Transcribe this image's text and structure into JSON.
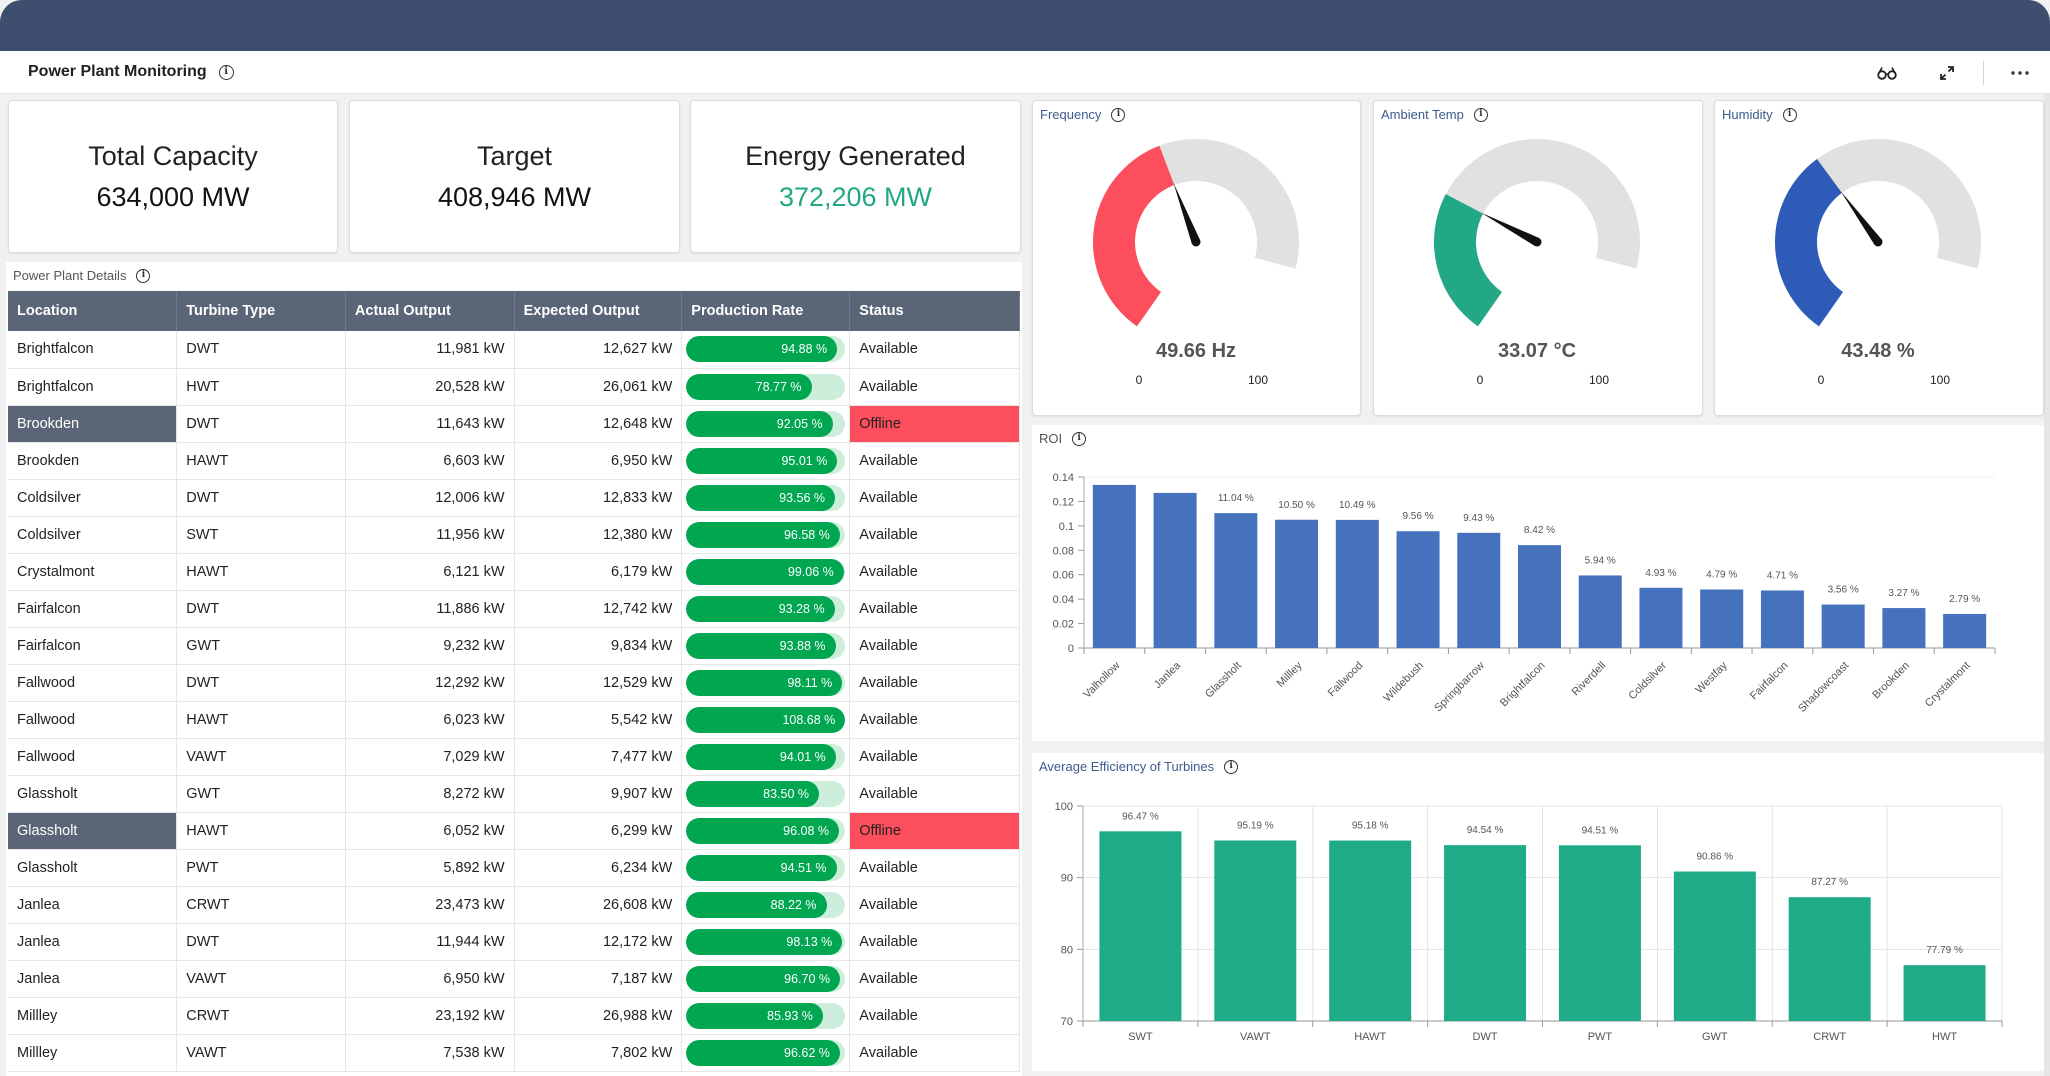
{
  "app": {
    "title": "Power Plant Monitoring",
    "actions": [
      {
        "name": "glasses-icon",
        "glyph": "⚇⚇"
      },
      {
        "name": "expand-icon",
        "glyph": "⤢"
      },
      {
        "name": "more-icon",
        "glyph": "⋯"
      }
    ]
  },
  "kpis": [
    {
      "label": "Total Capacity",
      "value": "634,000 MW",
      "color": "#111111"
    },
    {
      "label": "Target",
      "value": "408,946 MW",
      "color": "#111111"
    },
    {
      "label": "Energy Generated",
      "value": "372,206 MW",
      "color": "#22a884"
    }
  ],
  "details": {
    "title": "Power Plant Details",
    "columns": [
      "Location",
      "Turbine Type",
      "Actual Output",
      "Expected Output",
      "Production Rate",
      "Status"
    ],
    "rows": [
      {
        "location": "Brightfalcon",
        "type": "DWT",
        "actual": "11,981 kW",
        "expected": "12,627 kW",
        "rate": 94.88,
        "rate_label": "94.88 %",
        "status": "Available"
      },
      {
        "location": "Brightfalcon",
        "type": "HWT",
        "actual": "20,528 kW",
        "expected": "26,061 kW",
        "rate": 78.77,
        "rate_label": "78.77 %",
        "status": "Available"
      },
      {
        "location": "Brookden",
        "type": "DWT",
        "actual": "11,643 kW",
        "expected": "12,648 kW",
        "rate": 92.05,
        "rate_label": "92.05 %",
        "status": "Offline"
      },
      {
        "location": "Brookden",
        "type": "HAWT",
        "actual": "6,603 kW",
        "expected": "6,950 kW",
        "rate": 95.01,
        "rate_label": "95.01 %",
        "status": "Available"
      },
      {
        "location": "Coldsilver",
        "type": "DWT",
        "actual": "12,006 kW",
        "expected": "12,833 kW",
        "rate": 93.56,
        "rate_label": "93.56 %",
        "status": "Available"
      },
      {
        "location": "Coldsilver",
        "type": "SWT",
        "actual": "11,956 kW",
        "expected": "12,380 kW",
        "rate": 96.58,
        "rate_label": "96.58 %",
        "status": "Available"
      },
      {
        "location": "Crystalmont",
        "type": "HAWT",
        "actual": "6,121 kW",
        "expected": "6,179 kW",
        "rate": 99.06,
        "rate_label": "99.06 %",
        "status": "Available"
      },
      {
        "location": "Fairfalcon",
        "type": "DWT",
        "actual": "11,886 kW",
        "expected": "12,742 kW",
        "rate": 93.28,
        "rate_label": "93.28 %",
        "status": "Available"
      },
      {
        "location": "Fairfalcon",
        "type": "GWT",
        "actual": "9,232 kW",
        "expected": "9,834 kW",
        "rate": 93.88,
        "rate_label": "93.88 %",
        "status": "Available"
      },
      {
        "location": "Fallwood",
        "type": "DWT",
        "actual": "12,292 kW",
        "expected": "12,529 kW",
        "rate": 98.11,
        "rate_label": "98.11 %",
        "status": "Available"
      },
      {
        "location": "Fallwood",
        "type": "HAWT",
        "actual": "6,023 kW",
        "expected": "5,542 kW",
        "rate": 108.68,
        "rate_label": "108.68 %",
        "status": "Available"
      },
      {
        "location": "Fallwood",
        "type": "VAWT",
        "actual": "7,029 kW",
        "expected": "7,477 kW",
        "rate": 94.01,
        "rate_label": "94.01 %",
        "status": "Available"
      },
      {
        "location": "Glassholt",
        "type": "GWT",
        "actual": "8,272 kW",
        "expected": "9,907 kW",
        "rate": 83.5,
        "rate_label": "83.50 %",
        "status": "Available"
      },
      {
        "location": "Glassholt",
        "type": "HAWT",
        "actual": "6,052 kW",
        "expected": "6,299 kW",
        "rate": 96.08,
        "rate_label": "96.08 %",
        "status": "Offline"
      },
      {
        "location": "Glassholt",
        "type": "PWT",
        "actual": "5,892 kW",
        "expected": "6,234 kW",
        "rate": 94.51,
        "rate_label": "94.51 %",
        "status": "Available"
      },
      {
        "location": "Janlea",
        "type": "CRWT",
        "actual": "23,473 kW",
        "expected": "26,608 kW",
        "rate": 88.22,
        "rate_label": "88.22 %",
        "status": "Available"
      },
      {
        "location": "Janlea",
        "type": "DWT",
        "actual": "11,944 kW",
        "expected": "12,172 kW",
        "rate": 98.13,
        "rate_label": "98.13 %",
        "status": "Available"
      },
      {
        "location": "Janlea",
        "type": "VAWT",
        "actual": "6,950 kW",
        "expected": "7,187 kW",
        "rate": 96.7,
        "rate_label": "96.70 %",
        "status": "Available"
      },
      {
        "location": "Millley",
        "type": "CRWT",
        "actual": "23,192 kW",
        "expected": "26,988 kW",
        "rate": 85.93,
        "rate_label": "85.93 %",
        "status": "Available"
      },
      {
        "location": "Millley",
        "type": "VAWT",
        "actual": "7,538 kW",
        "expected": "7,802 kW",
        "rate": 96.62,
        "rate_label": "96.62 %",
        "status": "Available"
      }
    ],
    "colors": {
      "bar_fill": "#00a650",
      "bar_track": "#cdeedb",
      "offline": "#fd4e5d",
      "header": "#5a6577"
    }
  },
  "gauges": [
    {
      "title": "Frequency",
      "value": 49.66,
      "label": "49.66 Hz",
      "min": "0",
      "max": "100",
      "color": "#fd4e5d"
    },
    {
      "title": "Ambient Temp",
      "value": 33.07,
      "label": "33.07 °C",
      "min": "0",
      "max": "100",
      "color": "#22a884"
    },
    {
      "title": "Humidity",
      "value": 43.48,
      "label": "43.48 %",
      "min": "0",
      "max": "100",
      "color": "#2e5bb8"
    }
  ],
  "chart_data": [
    {
      "type": "bar",
      "title": "ROI",
      "xlabel": "",
      "ylabel": "",
      "categories": [
        "Valhollow",
        "Janlea",
        "Glassholt",
        "Millley",
        "Fallwood",
        "Wildebush",
        "Springbarrow",
        "Brightfalcon",
        "Riverdell",
        "Coldsilver",
        "Westfay",
        "Fairfalcon",
        "Shadowcoast",
        "Brookden",
        "Crystalmont"
      ],
      "values": [
        0.1335,
        0.127,
        0.1104,
        0.105,
        0.1049,
        0.0956,
        0.0943,
        0.0842,
        0.0594,
        0.0493,
        0.0479,
        0.0471,
        0.0356,
        0.0327,
        0.0279
      ],
      "data_labels": [
        "",
        "",
        "11.04 %",
        "10.50 %",
        "10.49 %",
        "9.56 %",
        "9.43 %",
        "8.42 %",
        "5.94 %",
        "4.93 %",
        "4.79 %",
        "4.71 %",
        "3.56 %",
        "3.27 %",
        "2.79 %"
      ],
      "yticks": [
        "0",
        "0.02",
        "0.04",
        "0.06",
        "0.08",
        "0.1",
        "0.12",
        "0.14"
      ],
      "ylim": [
        0,
        0.14
      ],
      "grid": false,
      "color": "#4571bd"
    },
    {
      "type": "bar",
      "title": "Average Efficiency of Turbines",
      "xlabel": "",
      "ylabel": "",
      "categories": [
        "SWT",
        "VAWT",
        "HAWT",
        "DWT",
        "PWT",
        "GWT",
        "CRWT",
        "HWT"
      ],
      "values": [
        96.47,
        95.19,
        95.18,
        94.54,
        94.51,
        90.86,
        87.27,
        77.79
      ],
      "data_labels": [
        "96.47 %",
        "95.19 %",
        "95.18 %",
        "94.54 %",
        "94.51 %",
        "90.86 %",
        "87.27 %",
        "77.79 %"
      ],
      "yticks": [
        "70",
        "80",
        "90",
        "100"
      ],
      "ylim": [
        70,
        100
      ],
      "grid": true,
      "color": "#20ab88"
    }
  ]
}
